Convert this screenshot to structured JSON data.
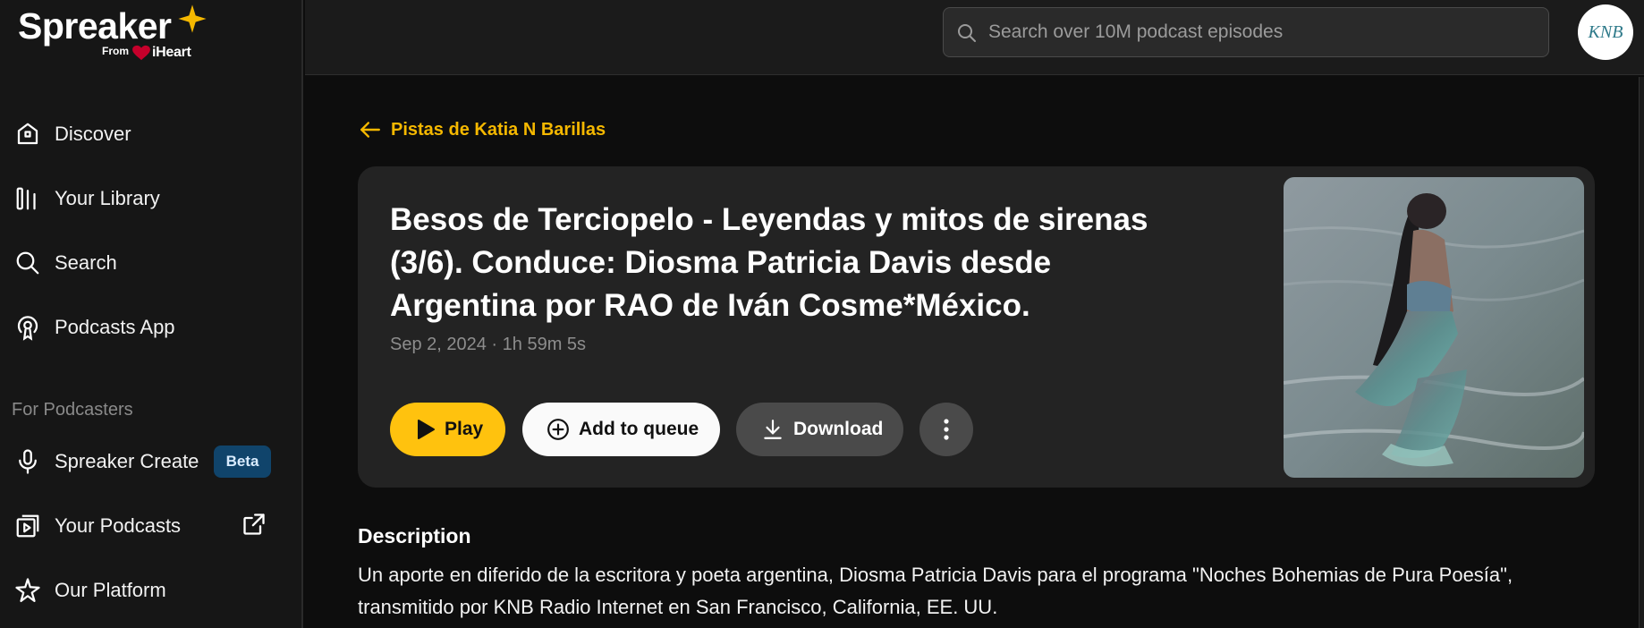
{
  "brand": {
    "name": "Spreaker",
    "from_label": "From",
    "partner": "iHeart",
    "star_color": "#f5b800"
  },
  "sidebar": {
    "items": [
      {
        "label": "Discover",
        "icon": "discover-icon"
      },
      {
        "label": "Your Library",
        "icon": "library-icon"
      },
      {
        "label": "Search",
        "icon": "search-icon"
      },
      {
        "label": "Podcasts App",
        "icon": "podcasts-app-icon"
      }
    ],
    "section_title": "For Podcasters",
    "podcaster_items": [
      {
        "label": "Spreaker Create",
        "icon": "microphone-icon",
        "badge": "Beta"
      },
      {
        "label": "Your Podcasts",
        "icon": "your-podcasts-icon",
        "trailing_icon": "external-link-icon"
      },
      {
        "label": "Our Platform",
        "icon": "platform-star-icon"
      }
    ]
  },
  "topbar": {
    "search_placeholder": "Search over 10M podcast episodes",
    "avatar_text": "KNB"
  },
  "main": {
    "back_link": "Pistas de Katia N Barillas",
    "episode": {
      "title": "Besos de Terciopelo - Leyendas y mitos de sirenas (3/6). Conduce: Diosma Patricia Davis desde Argentina por RAO de Iván Cosme*México.",
      "meta": "Sep 2, 2024 · 1h 59m 5s"
    },
    "actions": {
      "play": "Play",
      "queue": "Add to queue",
      "download": "Download"
    },
    "description": {
      "heading": "Description",
      "text": "Un aporte en diferido de la escritora y poeta argentina, Diosma Patricia Davis para el programa \"Noches Bohemias de Pura Poesía\", transmitido por KNB Radio Internet en San Francisco, California, EE. UU."
    }
  },
  "colors": {
    "accent": "#ffc20e",
    "link": "#f5b800",
    "beta_bg": "#10446b"
  }
}
